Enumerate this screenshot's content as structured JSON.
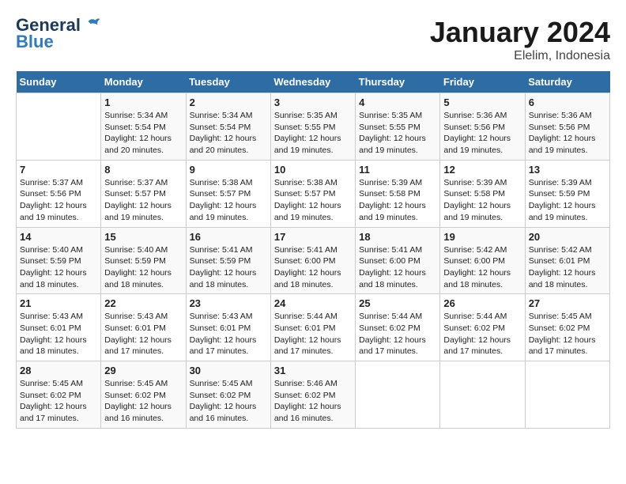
{
  "logo": {
    "line1": "General",
    "line2": "Blue"
  },
  "title": "January 2024",
  "subtitle": "Elelim, Indonesia",
  "days_header": [
    "Sunday",
    "Monday",
    "Tuesday",
    "Wednesday",
    "Thursday",
    "Friday",
    "Saturday"
  ],
  "weeks": [
    [
      {
        "num": "",
        "info": ""
      },
      {
        "num": "1",
        "info": "Sunrise: 5:34 AM\nSunset: 5:54 PM\nDaylight: 12 hours\nand 20 minutes."
      },
      {
        "num": "2",
        "info": "Sunrise: 5:34 AM\nSunset: 5:54 PM\nDaylight: 12 hours\nand 20 minutes."
      },
      {
        "num": "3",
        "info": "Sunrise: 5:35 AM\nSunset: 5:55 PM\nDaylight: 12 hours\nand 19 minutes."
      },
      {
        "num": "4",
        "info": "Sunrise: 5:35 AM\nSunset: 5:55 PM\nDaylight: 12 hours\nand 19 minutes."
      },
      {
        "num": "5",
        "info": "Sunrise: 5:36 AM\nSunset: 5:56 PM\nDaylight: 12 hours\nand 19 minutes."
      },
      {
        "num": "6",
        "info": "Sunrise: 5:36 AM\nSunset: 5:56 PM\nDaylight: 12 hours\nand 19 minutes."
      }
    ],
    [
      {
        "num": "7",
        "info": "Sunrise: 5:37 AM\nSunset: 5:56 PM\nDaylight: 12 hours\nand 19 minutes."
      },
      {
        "num": "8",
        "info": "Sunrise: 5:37 AM\nSunset: 5:57 PM\nDaylight: 12 hours\nand 19 minutes."
      },
      {
        "num": "9",
        "info": "Sunrise: 5:38 AM\nSunset: 5:57 PM\nDaylight: 12 hours\nand 19 minutes."
      },
      {
        "num": "10",
        "info": "Sunrise: 5:38 AM\nSunset: 5:57 PM\nDaylight: 12 hours\nand 19 minutes."
      },
      {
        "num": "11",
        "info": "Sunrise: 5:39 AM\nSunset: 5:58 PM\nDaylight: 12 hours\nand 19 minutes."
      },
      {
        "num": "12",
        "info": "Sunrise: 5:39 AM\nSunset: 5:58 PM\nDaylight: 12 hours\nand 19 minutes."
      },
      {
        "num": "13",
        "info": "Sunrise: 5:39 AM\nSunset: 5:59 PM\nDaylight: 12 hours\nand 19 minutes."
      }
    ],
    [
      {
        "num": "14",
        "info": "Sunrise: 5:40 AM\nSunset: 5:59 PM\nDaylight: 12 hours\nand 18 minutes."
      },
      {
        "num": "15",
        "info": "Sunrise: 5:40 AM\nSunset: 5:59 PM\nDaylight: 12 hours\nand 18 minutes."
      },
      {
        "num": "16",
        "info": "Sunrise: 5:41 AM\nSunset: 5:59 PM\nDaylight: 12 hours\nand 18 minutes."
      },
      {
        "num": "17",
        "info": "Sunrise: 5:41 AM\nSunset: 6:00 PM\nDaylight: 12 hours\nand 18 minutes."
      },
      {
        "num": "18",
        "info": "Sunrise: 5:41 AM\nSunset: 6:00 PM\nDaylight: 12 hours\nand 18 minutes."
      },
      {
        "num": "19",
        "info": "Sunrise: 5:42 AM\nSunset: 6:00 PM\nDaylight: 12 hours\nand 18 minutes."
      },
      {
        "num": "20",
        "info": "Sunrise: 5:42 AM\nSunset: 6:01 PM\nDaylight: 12 hours\nand 18 minutes."
      }
    ],
    [
      {
        "num": "21",
        "info": "Sunrise: 5:43 AM\nSunset: 6:01 PM\nDaylight: 12 hours\nand 18 minutes."
      },
      {
        "num": "22",
        "info": "Sunrise: 5:43 AM\nSunset: 6:01 PM\nDaylight: 12 hours\nand 17 minutes."
      },
      {
        "num": "23",
        "info": "Sunrise: 5:43 AM\nSunset: 6:01 PM\nDaylight: 12 hours\nand 17 minutes."
      },
      {
        "num": "24",
        "info": "Sunrise: 5:44 AM\nSunset: 6:01 PM\nDaylight: 12 hours\nand 17 minutes."
      },
      {
        "num": "25",
        "info": "Sunrise: 5:44 AM\nSunset: 6:02 PM\nDaylight: 12 hours\nand 17 minutes."
      },
      {
        "num": "26",
        "info": "Sunrise: 5:44 AM\nSunset: 6:02 PM\nDaylight: 12 hours\nand 17 minutes."
      },
      {
        "num": "27",
        "info": "Sunrise: 5:45 AM\nSunset: 6:02 PM\nDaylight: 12 hours\nand 17 minutes."
      }
    ],
    [
      {
        "num": "28",
        "info": "Sunrise: 5:45 AM\nSunset: 6:02 PM\nDaylight: 12 hours\nand 17 minutes."
      },
      {
        "num": "29",
        "info": "Sunrise: 5:45 AM\nSunset: 6:02 PM\nDaylight: 12 hours\nand 16 minutes."
      },
      {
        "num": "30",
        "info": "Sunrise: 5:45 AM\nSunset: 6:02 PM\nDaylight: 12 hours\nand 16 minutes."
      },
      {
        "num": "31",
        "info": "Sunrise: 5:46 AM\nSunset: 6:02 PM\nDaylight: 12 hours\nand 16 minutes."
      },
      {
        "num": "",
        "info": ""
      },
      {
        "num": "",
        "info": ""
      },
      {
        "num": "",
        "info": ""
      }
    ]
  ]
}
